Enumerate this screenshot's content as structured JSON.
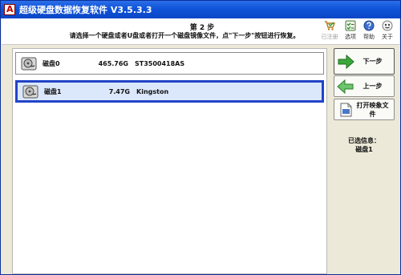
{
  "window": {
    "title": "超级硬盘数据恢复软件 V3.5.3.3"
  },
  "header": {
    "step_title": "第 2 步",
    "step_description": "请选择一个硬盘或者U盘或者打开一个磁盘镜像文件，点\"下一步\"按钮进行恢复。"
  },
  "toolbar": {
    "registered_label": "已注册",
    "options_label": "选项",
    "help_label": "帮助",
    "about_label": "关于"
  },
  "disks": [
    {
      "name": "磁盘0",
      "size": "465.76G",
      "model": "ST3500418AS",
      "selected": false
    },
    {
      "name": "磁盘1",
      "size": "7.47G",
      "model": "Kingston",
      "selected": true
    }
  ],
  "actions": {
    "next_label": "下一步",
    "prev_label": "上一步",
    "open_image_label": "打开映象文件"
  },
  "selection": {
    "label": "已选信息：",
    "value": "磁盘1"
  }
}
